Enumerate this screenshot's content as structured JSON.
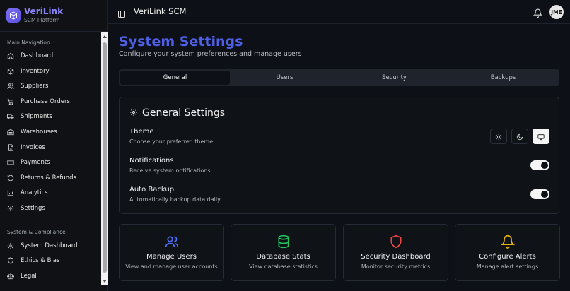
{
  "brand": {
    "name": "VeriLink",
    "subtitle": "SCM Platform"
  },
  "sidebar": {
    "section_main": "Main Navigation",
    "main_items": [
      {
        "label": "Dashboard",
        "icon": "home-icon"
      },
      {
        "label": "Inventory",
        "icon": "box-icon"
      },
      {
        "label": "Suppliers",
        "icon": "users-icon"
      },
      {
        "label": "Purchase Orders",
        "icon": "cart-icon"
      },
      {
        "label": "Shipments",
        "icon": "truck-icon"
      },
      {
        "label": "Warehouses",
        "icon": "warehouse-icon"
      },
      {
        "label": "Invoices",
        "icon": "file-icon"
      },
      {
        "label": "Payments",
        "icon": "credit-card-icon"
      },
      {
        "label": "Returns & Refunds",
        "icon": "rotate-icon"
      },
      {
        "label": "Analytics",
        "icon": "bar-chart-icon"
      },
      {
        "label": "Settings",
        "icon": "gear-icon"
      }
    ],
    "section_system": "System & Compliance",
    "system_items": [
      {
        "label": "System Dashboard",
        "icon": "gear-icon"
      },
      {
        "label": "Ethics & Bias",
        "icon": "shield-icon"
      },
      {
        "label": "Legal",
        "icon": "scale-icon"
      }
    ]
  },
  "header": {
    "title": "VeriLink SCM",
    "avatar_initials": "JME"
  },
  "page": {
    "title": "System Settings",
    "subtitle": "Configure your system preferences and manage users"
  },
  "tabs": [
    "General",
    "Users",
    "Security",
    "Backups"
  ],
  "general": {
    "title": "General Settings",
    "theme": {
      "name": "Theme",
      "desc": "Choose your preferred theme",
      "selected": "system"
    },
    "notifications": {
      "name": "Notifications",
      "desc": "Receive system notifications",
      "enabled": true
    },
    "backup": {
      "name": "Auto Backup",
      "desc": "Automatically backup data daily",
      "enabled": true
    }
  },
  "quick_cards": [
    {
      "title": "Manage Users",
      "desc": "View and manage user accounts",
      "icon": "users-icon",
      "color": "#4f6ef7"
    },
    {
      "title": "Database Stats",
      "desc": "View database statistics",
      "icon": "database-icon",
      "color": "#22c55e"
    },
    {
      "title": "Security Dashboard",
      "desc": "Monitor security metrics",
      "icon": "shield-icon",
      "color": "#ef4444"
    },
    {
      "title": "Configure Alerts",
      "desc": "Manage alert settings",
      "icon": "bell-icon",
      "color": "#eab308"
    }
  ]
}
